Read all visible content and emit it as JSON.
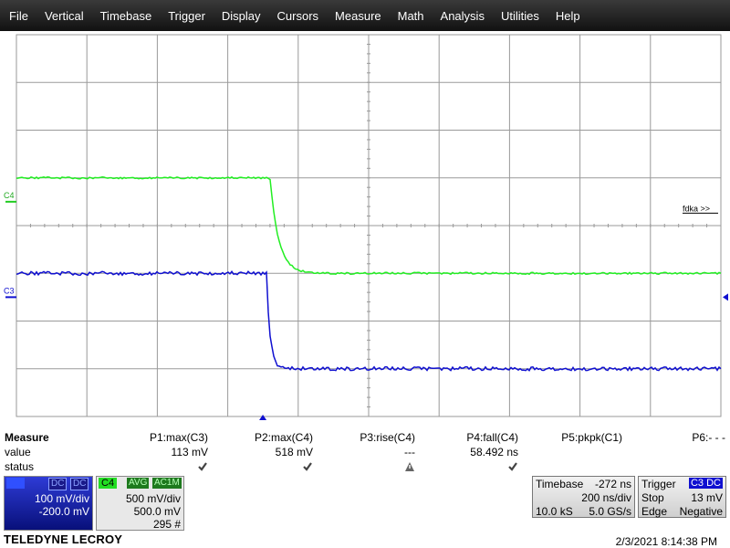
{
  "menu": [
    "File",
    "Vertical",
    "Timebase",
    "Trigger",
    "Display",
    "Cursors",
    "Measure",
    "Math",
    "Analysis",
    "Utilities",
    "Help"
  ],
  "colors": {
    "c4_trace": "#22ee22",
    "c3_trace": "#1010d0",
    "grid": "#9a9a9a",
    "menubar": "#1c1c1c"
  },
  "display": {
    "c4_label": "C4",
    "c3_label": "C3",
    "overlay_text": "fdka >>",
    "c4_trace": {
      "high_div": -1.0,
      "low_div": 1.0,
      "edge_time_div": 3.6,
      "level_unit": "div"
    },
    "c3_trace": {
      "high_div": 1.0,
      "low_div": 3.0,
      "edge_time_div": 3.55,
      "level_unit": "div"
    }
  },
  "measure": {
    "header": "Measure",
    "row_value": "value",
    "row_status": "status",
    "params": [
      {
        "name": "P1:max(C3)",
        "value": "113 mV",
        "status": "check-icon"
      },
      {
        "name": "P2:max(C4)",
        "value": "518 mV",
        "status": "check-icon"
      },
      {
        "name": "P3:rise(C4)",
        "value": "---",
        "status": "warning-icon"
      },
      {
        "name": "P4:fall(C4)",
        "value": "58.492 ns",
        "status": "check-icon"
      },
      {
        "name": "P5:pkpk(C1)",
        "value": "",
        "status": ""
      },
      {
        "name": "P6:- - -",
        "value": "",
        "status": ""
      }
    ]
  },
  "channels": {
    "c3": {
      "tag": "C3",
      "badge1": "DC",
      "badge2": "DC",
      "vdiv": "100 mV/div",
      "offset": "-200.0 mV"
    },
    "c4": {
      "tag": "C4",
      "badge1": "AVG",
      "badge2": "AC1M",
      "vdiv": "500 mV/div",
      "offset": "500.0 mV",
      "count": "295 #"
    }
  },
  "timebase": {
    "label": "Timebase",
    "delay": "-272 ns",
    "tdiv": "200 ns/div",
    "samples": "10.0 kS",
    "rate": "5.0 GS/s"
  },
  "trigger": {
    "label": "Trigger",
    "source": "C3",
    "coupling": "DC",
    "mode": "Stop",
    "level": "13 mV",
    "type": "Edge",
    "slope": "Negative"
  },
  "brand": "TELEDYNE LECROY",
  "timestamp": "2/3/2021 8:14:38 PM"
}
